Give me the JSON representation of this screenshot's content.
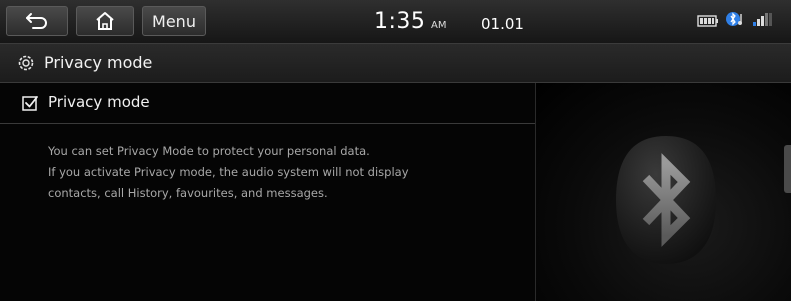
{
  "topbar": {
    "back_icon": "back-arrow-icon",
    "home_icon": "home-icon",
    "menu_label": "Menu",
    "time": "1:35",
    "ampm": "AM",
    "date": "01.01",
    "status_icons": [
      "battery-icon",
      "bluetooth-audio-icon",
      "signal-icon"
    ]
  },
  "titlebar": {
    "icon": "gear-icon",
    "title": "Privacy mode"
  },
  "option": {
    "checked": true,
    "label": "Privacy mode"
  },
  "description": [
    "You can set Privacy Mode to protect your personal data.",
    "If you activate Privacy mode, the audio system will not display",
    "contacts, call History, favourites, and messages."
  ],
  "illustration": "bluetooth-icon"
}
